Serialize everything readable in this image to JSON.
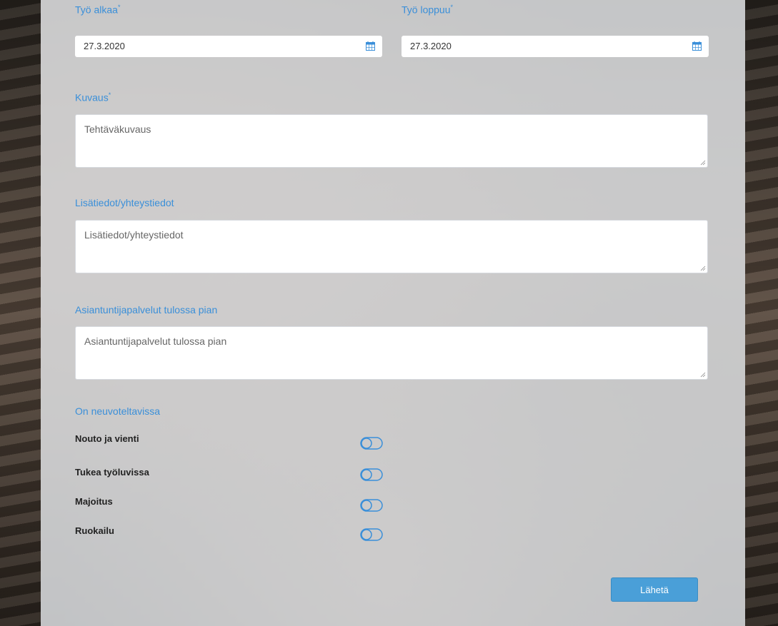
{
  "form": {
    "start": {
      "label": "Työ alkaa",
      "required_mark": "*",
      "value": "27.3.2020",
      "icon": "calendar-icon"
    },
    "end": {
      "label": "Työ loppuu",
      "required_mark": "*",
      "value": "27.3.2020",
      "icon": "calendar-icon"
    },
    "description": {
      "label": "Kuvaus",
      "required_mark": "*",
      "placeholder": "Tehtäväkuvaus",
      "value": ""
    },
    "additional": {
      "label": "Lisätiedot/yhteystiedot",
      "placeholder": "Lisätiedot/yhteystiedot",
      "value": ""
    },
    "expert": {
      "label": "Asiantuntijapalvelut tulossa pian",
      "placeholder": "Asiantuntijapalvelut tulossa pian",
      "value": ""
    },
    "negotiable": {
      "label": "On neuvoteltavissa",
      "options": [
        {
          "label": "Nouto ja vienti",
          "checked": false
        },
        {
          "label": "Tukea työluvissa",
          "checked": false
        },
        {
          "label": "Majoitus",
          "checked": false
        },
        {
          "label": "Ruokailu",
          "checked": false
        }
      ]
    },
    "submit_label": "Lähetä"
  },
  "colors": {
    "accent": "#3a8fd9",
    "button": "#4a9fd8"
  }
}
